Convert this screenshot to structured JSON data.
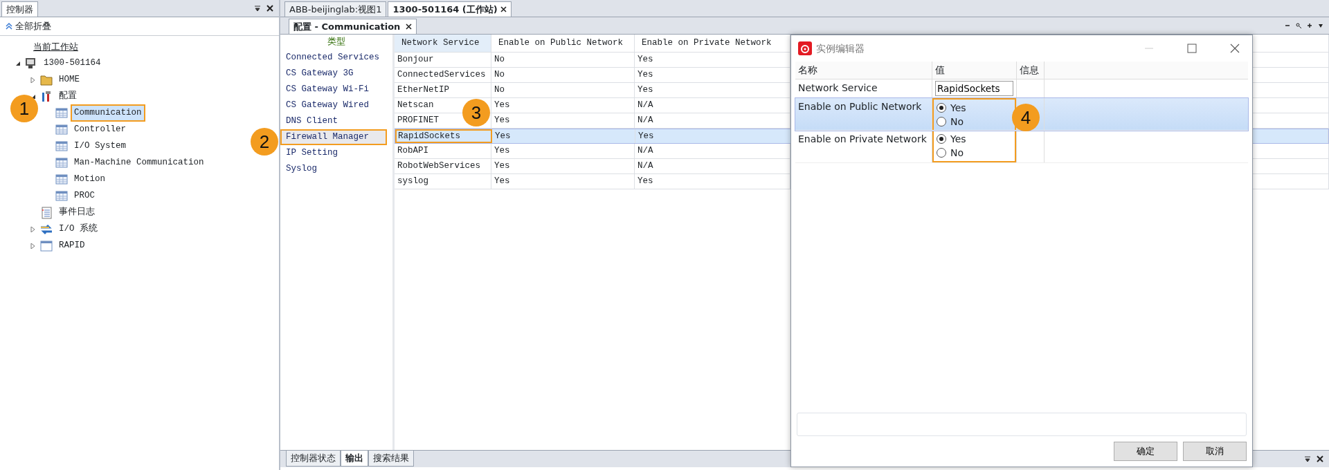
{
  "left_panel": {
    "tab": "控制器",
    "collapse_all": "全部折叠",
    "tree": [
      {
        "label": "当前工作站",
        "kind": "header"
      },
      {
        "label": "1300-501164",
        "kind": "monitor",
        "expanded": true,
        "children": [
          {
            "label": "HOME",
            "kind": "folder",
            "expanded": false
          },
          {
            "label": "配置",
            "kind": "tools",
            "expanded": true,
            "children": [
              {
                "label": "Communication",
                "kind": "table",
                "selected": true,
                "highlighted": true
              },
              {
                "label": "Controller",
                "kind": "table",
                "selected": false,
                "highlighted": false
              },
              {
                "label": "I/O System",
                "kind": "table",
                "selected": false,
                "highlighted": false
              },
              {
                "label": "Man-Machine Communication",
                "kind": "table",
                "selected": false,
                "highlighted": false
              },
              {
                "label": "Motion",
                "kind": "table",
                "selected": false,
                "highlighted": false
              },
              {
                "label": "PROC",
                "kind": "table",
                "selected": false,
                "highlighted": false
              }
            ]
          },
          {
            "label": "事件日志",
            "kind": "log"
          },
          {
            "label": "I/O 系统",
            "kind": "io",
            "expanded": false
          },
          {
            "label": "RAPID",
            "kind": "window",
            "expanded": false
          }
        ]
      }
    ]
  },
  "document_tabs": [
    {
      "label": "ABB-beijinglab:视图1",
      "selected": false
    },
    {
      "label": "1300-501164 (工作站)",
      "selected": true
    }
  ],
  "sub_tab": "配置 - Communication",
  "type_list": {
    "header": "类型",
    "items": [
      {
        "label": "Connected Services",
        "selected": false,
        "highlighted": false
      },
      {
        "label": "CS Gateway 3G",
        "selected": false,
        "highlighted": false
      },
      {
        "label": "CS Gateway Wi-Fi",
        "selected": false,
        "highlighted": false
      },
      {
        "label": "CS Gateway Wired",
        "selected": false,
        "highlighted": false
      },
      {
        "label": "DNS Client",
        "selected": false,
        "highlighted": false
      },
      {
        "label": "Firewall Manager",
        "selected": true,
        "highlighted": true
      },
      {
        "label": "IP Setting",
        "selected": false,
        "highlighted": false
      },
      {
        "label": "Syslog",
        "selected": false,
        "highlighted": false
      }
    ]
  },
  "table": {
    "columns": [
      "Network Service",
      "Enable on Public Network",
      "Enable on Private Network"
    ],
    "rows": [
      {
        "cells": [
          "Bonjour",
          "No",
          "Yes"
        ],
        "selected": false,
        "highlighted": false
      },
      {
        "cells": [
          "ConnectedServices",
          "No",
          "Yes"
        ],
        "selected": false,
        "highlighted": false
      },
      {
        "cells": [
          "EtherNetIP",
          "No",
          "Yes"
        ],
        "selected": false,
        "highlighted": false
      },
      {
        "cells": [
          "Netscan",
          "Yes",
          "N/A"
        ],
        "selected": false,
        "highlighted": false
      },
      {
        "cells": [
          "PROFINET",
          "Yes",
          "N/A"
        ],
        "selected": false,
        "highlighted": false
      },
      {
        "cells": [
          "RapidSockets",
          "Yes",
          "Yes"
        ],
        "selected": true,
        "highlighted": true
      },
      {
        "cells": [
          "RobAPI",
          "Yes",
          "N/A"
        ],
        "selected": false,
        "highlighted": false
      },
      {
        "cells": [
          "RobotWebServices",
          "Yes",
          "N/A"
        ],
        "selected": false,
        "highlighted": false
      },
      {
        "cells": [
          "syslog",
          "Yes",
          "Yes"
        ],
        "selected": false,
        "highlighted": false
      }
    ]
  },
  "bottom_tabs": [
    {
      "label": "控制器状态",
      "selected": false
    },
    {
      "label": "输出",
      "selected": true
    },
    {
      "label": "搜索结果",
      "selected": false
    }
  ],
  "dialog": {
    "title": "实例编辑器",
    "columns": [
      "名称",
      "值",
      "信息"
    ],
    "rows": [
      {
        "name": "Network Service",
        "kind": "text",
        "value": "RapidSockets",
        "selected": false
      },
      {
        "name": "Enable on Public Network",
        "kind": "radio",
        "selected": true,
        "options": [
          {
            "label": "Yes",
            "selected": true
          },
          {
            "label": "No",
            "selected": false
          }
        ]
      },
      {
        "name": "Enable on Private Network",
        "kind": "radio",
        "selected": false,
        "options": [
          {
            "label": "Yes",
            "selected": true
          },
          {
            "label": "No",
            "selected": false
          }
        ]
      }
    ],
    "buttons": [
      "确定",
      "取消"
    ]
  },
  "markers": [
    "1",
    "2",
    "3",
    "4"
  ]
}
